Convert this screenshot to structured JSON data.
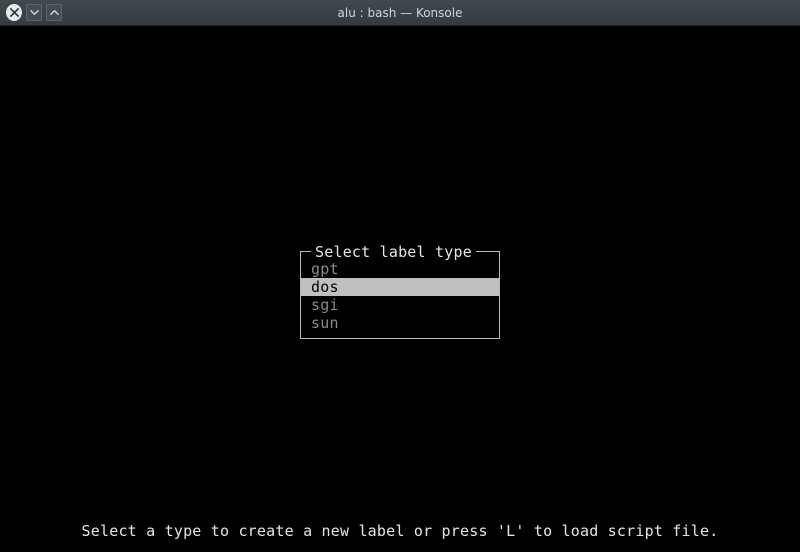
{
  "window": {
    "title": "alu : bash — Konsole"
  },
  "dialog": {
    "title": "Select label type",
    "options": [
      "gpt",
      "dos",
      "sgi",
      "sun"
    ],
    "selected_index": 1
  },
  "hint": "Select a type to create a new label or press 'L' to load script file."
}
